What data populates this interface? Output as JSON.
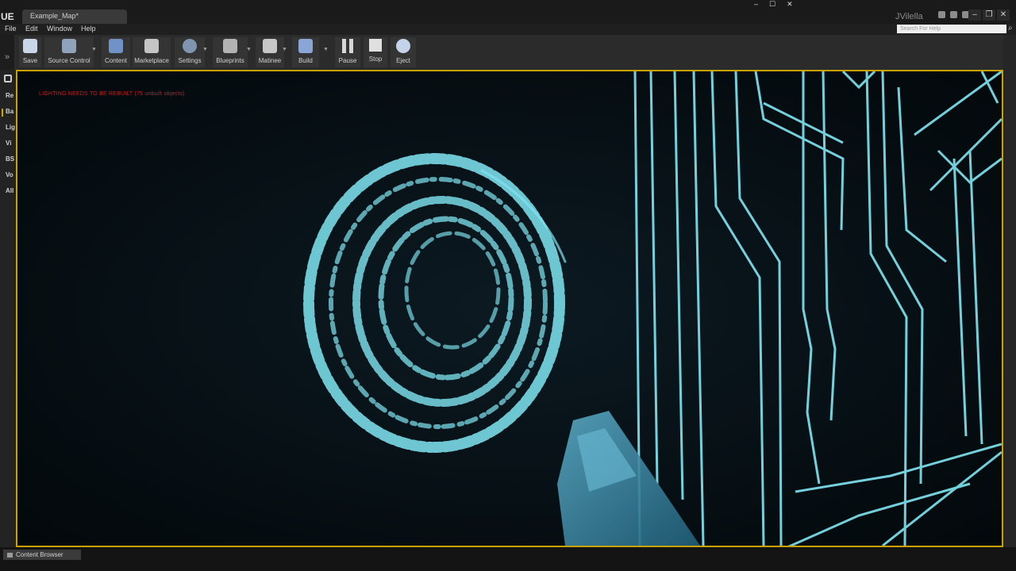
{
  "title_bar": {
    "app_logo": "UE",
    "document_tab": "Example_Map*",
    "user": "JVilella",
    "icons": [
      "chat-icon",
      "person-icon",
      "gear-icon"
    ],
    "window_controls": [
      "–",
      "❐",
      "✕"
    ],
    "os_controls": [
      "–",
      "☐",
      "✕"
    ]
  },
  "menu": {
    "items": [
      "File",
      "Edit",
      "Window",
      "Help"
    ],
    "search_placeholder": "Search For Help"
  },
  "toolbar": {
    "buttons": [
      {
        "label": "Save",
        "icon": "save-icon",
        "color": "#c9d6e8"
      },
      {
        "label": "Source Control",
        "icon": "source-control-icon",
        "color": "#8fa3bd"
      },
      {
        "label": "Content",
        "icon": "content-icon",
        "color": "#6f92c7"
      },
      {
        "label": "Marketplace",
        "icon": "marketplace-icon",
        "color": "#c4c4c4"
      },
      {
        "label": "Settings",
        "icon": "settings-icon",
        "color": "#7f95b0"
      },
      {
        "label": "Blueprints",
        "icon": "blueprints-icon",
        "color": "#b3b3b3"
      },
      {
        "label": "Matinee",
        "icon": "matinee-icon",
        "color": "#c7c7c7"
      },
      {
        "label": "Build",
        "icon": "build-icon",
        "color": "#8aa5d6"
      },
      {
        "label": "Pause",
        "icon": "pause-icon",
        "color": "#d7d7d7"
      },
      {
        "label": "Stop",
        "icon": "stop-icon",
        "color": "#e0e0e0"
      },
      {
        "label": "Eject",
        "icon": "eject-icon",
        "color": "#c2d3ea"
      }
    ]
  },
  "modes": {
    "items": [
      "Re",
      "Ba",
      "Lig",
      "Vi",
      "BS",
      "Vo",
      "All"
    ]
  },
  "viewport": {
    "warning": "LIGHTING NEEDS TO BE REBUILT (75 unbuilt objects)",
    "accent_color": "#7fe6f2",
    "border_color": "#c9a200"
  },
  "bottom": {
    "content_browser_tab": "Content Browser"
  }
}
